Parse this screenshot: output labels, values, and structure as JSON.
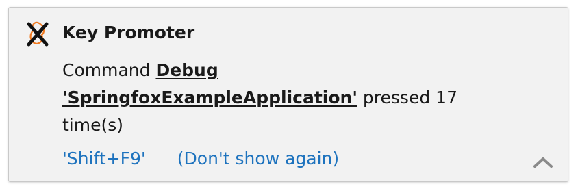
{
  "notification": {
    "title": "Key Promoter",
    "icon": "key-promoter-icon",
    "message": {
      "prefix": "Command ",
      "command_line1": "Debug",
      "command_line2": "'SpringfoxExampleApplication'",
      "pressed_text": " pressed 17",
      "suffix": "time(s)"
    },
    "actions": {
      "shortcut": "'Shift+F9'",
      "dont_show": "(Don't show again)"
    },
    "collapse_icon": "chevron-up-icon",
    "colors": {
      "background": "#f2f2f2",
      "link": "#1e73be",
      "icon_accent": "#f07a21"
    }
  }
}
